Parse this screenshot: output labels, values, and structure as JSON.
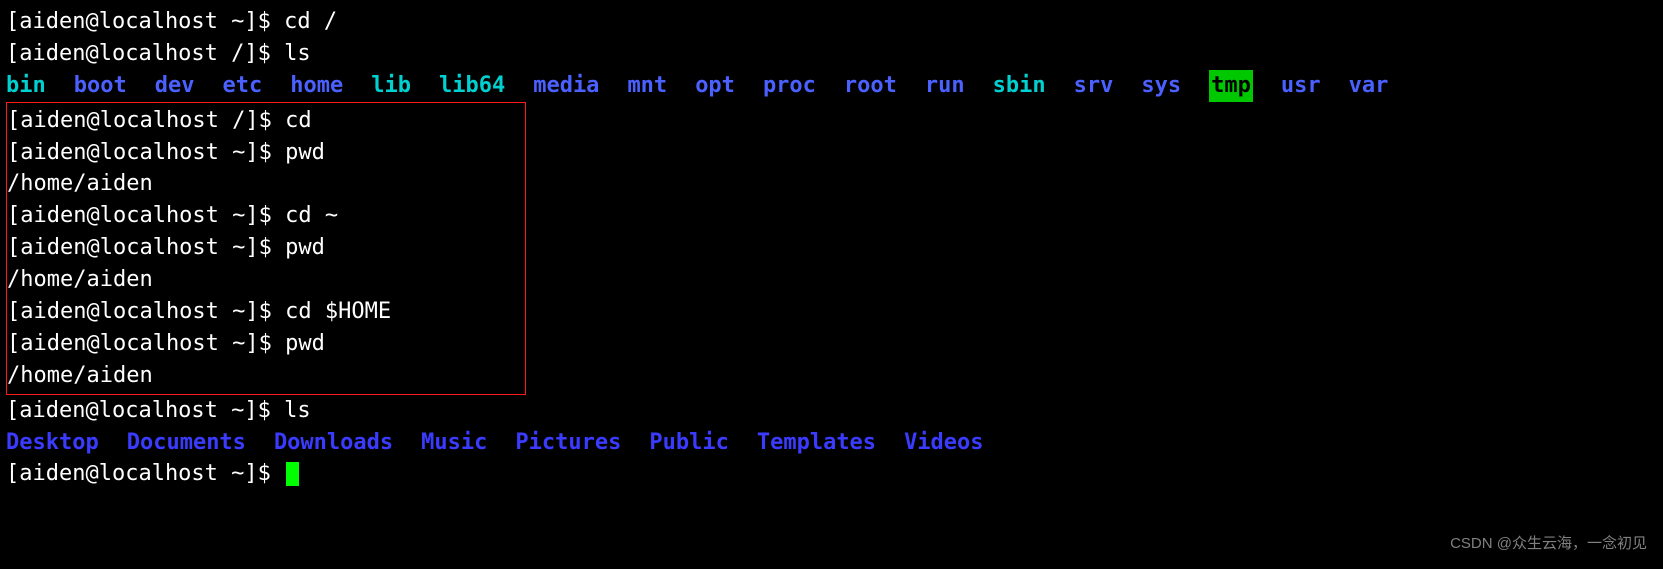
{
  "lines": {
    "l1_prompt": "[aiden@localhost ~]$ ",
    "l1_cmd": "cd /",
    "l2_prompt": "[aiden@localhost /]$ ",
    "l2_cmd": "ls",
    "ls_root": [
      {
        "name": "bin",
        "style": "dir-cyan"
      },
      {
        "name": "boot",
        "style": "dir-blue"
      },
      {
        "name": "dev",
        "style": "dir-blue"
      },
      {
        "name": "etc",
        "style": "dir-blue"
      },
      {
        "name": "home",
        "style": "dir-blue"
      },
      {
        "name": "lib",
        "style": "dir-cyan"
      },
      {
        "name": "lib64",
        "style": "dir-cyan"
      },
      {
        "name": "media",
        "style": "dir-blue"
      },
      {
        "name": "mnt",
        "style": "dir-blue"
      },
      {
        "name": "opt",
        "style": "dir-blue"
      },
      {
        "name": "proc",
        "style": "dir-blue"
      },
      {
        "name": "root",
        "style": "dir-blue"
      },
      {
        "name": "run",
        "style": "dir-blue"
      },
      {
        "name": "sbin",
        "style": "dir-cyan"
      },
      {
        "name": "srv",
        "style": "dir-blue"
      },
      {
        "name": "sys",
        "style": "dir-blue"
      },
      {
        "name": "tmp",
        "style": "tmp-highlight"
      },
      {
        "name": "usr",
        "style": "dir-blue"
      },
      {
        "name": "var",
        "style": "dir-blue"
      }
    ],
    "box": {
      "b1_prompt": "[aiden@localhost /]$ ",
      "b1_cmd": "cd",
      "b2_prompt": "[aiden@localhost ~]$ ",
      "b2_cmd": "pwd",
      "b3_out": "/home/aiden",
      "b4_prompt": "[aiden@localhost ~]$ ",
      "b4_cmd": "cd ~",
      "b5_prompt": "[aiden@localhost ~]$ ",
      "b5_cmd": "pwd",
      "b6_out": "/home/aiden",
      "b7_prompt": "[aiden@localhost ~]$ ",
      "b7_cmd": "cd $HOME",
      "b8_prompt": "[aiden@localhost ~]$ ",
      "b8_cmd": "pwd",
      "b9_out": "/home/aiden"
    },
    "l_after_box_prompt": "[aiden@localhost ~]$ ",
    "l_after_box_cmd": "ls",
    "ls_home": [
      {
        "name": "Desktop",
        "style": "dir-blue2"
      },
      {
        "name": "Documents",
        "style": "dir-blue2"
      },
      {
        "name": "Downloads",
        "style": "dir-blue2"
      },
      {
        "name": "Music",
        "style": "dir-blue2"
      },
      {
        "name": "Pictures",
        "style": "dir-blue2"
      },
      {
        "name": "Public",
        "style": "dir-blue2"
      },
      {
        "name": "Templates",
        "style": "dir-blue2"
      },
      {
        "name": "Videos",
        "style": "dir-blue2"
      }
    ],
    "last_prompt": "[aiden@localhost ~]$ "
  },
  "watermark": "CSDN @众生云海，一念初见"
}
